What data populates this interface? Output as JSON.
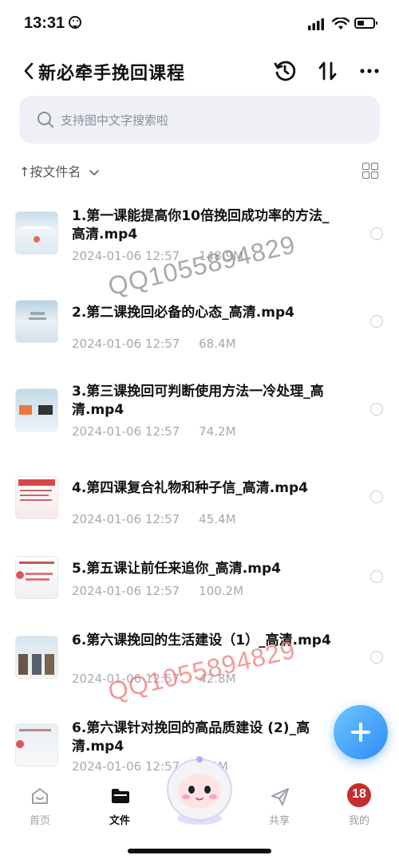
{
  "status": {
    "time": "13:31"
  },
  "header": {
    "title": "新必牵手挽回课程"
  },
  "search": {
    "placeholder": "支持图中文字搜索啦"
  },
  "sort": {
    "label": "↑按文件名"
  },
  "files": [
    {
      "name": "1.第一课能提高你10倍挽回成功率的方法_高清.mp4",
      "date": "2024-01-06 12:57",
      "size": "148.9M"
    },
    {
      "name": "2.第二课挽回必备的心态_高清.mp4",
      "date": "2024-01-06 12:57",
      "size": "68.4M"
    },
    {
      "name": "3.第三课挽回可判断使用方法一冷处理_高清.mp4",
      "date": "2024-01-06 12:57",
      "size": "74.2M"
    },
    {
      "name": "4.第四课复合礼物和种子信_高清.mp4",
      "date": "2024-01-06 12:57",
      "size": "45.4M"
    },
    {
      "name": "5.第五课让前任来追你_高清.mp4",
      "date": "2024-01-06 12:57",
      "size": "100.2M"
    },
    {
      "name": "6.第六课挽回的生活建设（1）_高清.mp4",
      "date": "2024-01-06 12:57",
      "size": "42.8M"
    },
    {
      "name": "6.第六课针对挽回的高品质建设 (2)_高清.mp4",
      "date": "2024-01-06 12:57",
      "size": "8.0M"
    }
  ],
  "watermarks": [
    "QQ1055894829",
    "QQ1055894829"
  ],
  "tabs": [
    {
      "label": "首页",
      "icon": "home-icon"
    },
    {
      "label": "文件",
      "icon": "folder-icon"
    },
    {
      "label": "",
      "icon": "mascot-icon"
    },
    {
      "label": "共享",
      "icon": "send-icon"
    },
    {
      "label": "我的",
      "icon": "avatar-icon"
    }
  ],
  "badge": "18",
  "colors": {
    "accent": "#2f8df5",
    "muted": "#a7a9b0",
    "watermark_red": "#ee7878"
  }
}
